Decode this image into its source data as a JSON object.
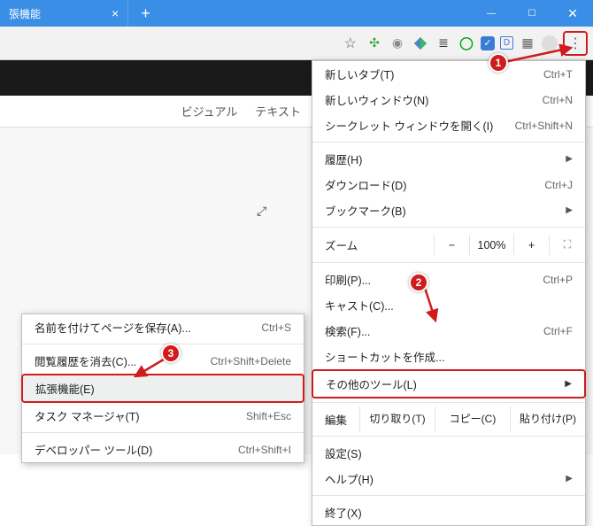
{
  "titlebar": {
    "tab_title": "張機能",
    "tab_close": "×",
    "new_tab": "+",
    "win_min": "—",
    "win_max": "☐",
    "win_close": "✕"
  },
  "toolbar": {
    "star": "☆",
    "icons": [
      "clover",
      "gray-circle",
      "color-diamond",
      "stack",
      "green-ring",
      "blue-check",
      "box-d",
      "grid",
      "profile"
    ],
    "menu_dots": "⋮"
  },
  "mode": {
    "visual": "ビジュアル",
    "text": "テキスト"
  },
  "expand_glyph": "⤢",
  "menu": {
    "new_tab": {
      "label": "新しいタブ(T)",
      "shortcut": "Ctrl+T"
    },
    "new_window": {
      "label": "新しいウィンドウ(N)",
      "shortcut": "Ctrl+N"
    },
    "incognito": {
      "label": "シークレット ウィンドウを開く(I)",
      "shortcut": "Ctrl+Shift+N"
    },
    "history": {
      "label": "履歴(H)"
    },
    "downloads": {
      "label": "ダウンロード(D)",
      "shortcut": "Ctrl+J"
    },
    "bookmarks": {
      "label": "ブックマーク(B)"
    },
    "zoom_label": "ズーム",
    "zoom_minus": "−",
    "zoom_val": "100%",
    "zoom_plus": "+",
    "zoom_fs": "⛶",
    "print": {
      "label": "印刷(P)...",
      "shortcut": "Ctrl+P"
    },
    "cast": {
      "label": "キャスト(C)..."
    },
    "find": {
      "label": "検索(F)...",
      "shortcut": "Ctrl+F"
    },
    "shortcut_create": {
      "label": "ショートカットを作成..."
    },
    "more_tools": {
      "label": "その他のツール(L)"
    },
    "edit_label": "編集",
    "cut": "切り取り(T)",
    "copy": "コピー(C)",
    "paste": "貼り付け(P)",
    "settings": {
      "label": "設定(S)"
    },
    "help": {
      "label": "ヘルプ(H)"
    },
    "exit": {
      "label": "終了(X)"
    }
  },
  "submenu": {
    "save_as": {
      "label": "名前を付けてページを保存(A)...",
      "shortcut": "Ctrl+S"
    },
    "clear_history": {
      "label": "閲覧履歴を消去(C)...",
      "shortcut": "Ctrl+Shift+Delete"
    },
    "extensions": {
      "label": "拡張機能(E)"
    },
    "task_manager": {
      "label": "タスク マネージャ(T)",
      "shortcut": "Shift+Esc"
    },
    "dev_tools": {
      "label": "デベロッパー ツール(D)",
      "shortcut": "Ctrl+Shift+I"
    }
  },
  "badges": {
    "one": "1",
    "two": "2",
    "three": "3"
  }
}
